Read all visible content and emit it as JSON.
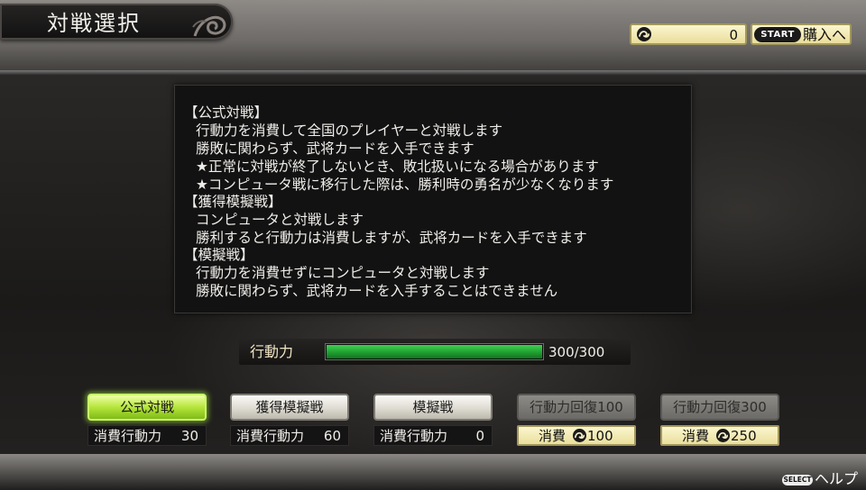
{
  "screen": {
    "title": "対戦選択"
  },
  "currency": {
    "icon": "coin-icon",
    "value": "0"
  },
  "header": {
    "start_badge": "START",
    "purchase_label": "購入へ"
  },
  "description": {
    "lines": [
      "【公式対戦】",
      "行動力を消費して全国のプレイヤーと対戦します",
      "勝敗に関わらず、武将カードを入手できます",
      "★正常に対戦が終了しないとき、敗北扱いになる場合があります",
      "★コンピュータ戦に移行した際は、勝利時の勇名が少なくなります",
      "【獲得模擬戦】",
      "コンピュータと対戦します",
      "勝利すると行動力は消費しますが、武将カードを入手できます",
      "【模擬戦】",
      "行動力を消費せずにコンピュータと対戦します",
      "勝敗に関わらず、武将カードを入手することはできません"
    ]
  },
  "stamina": {
    "label": "行動力",
    "value": "300/300",
    "current": 300,
    "max": 300,
    "fill_fraction": 1.0
  },
  "modes": [
    {
      "label": "公式対戦",
      "state": "selected",
      "cost_label": "消費行動力",
      "cost_value": "30"
    },
    {
      "label": "獲得模擬戦",
      "state": "normal",
      "cost_label": "消費行動力",
      "cost_value": "60"
    },
    {
      "label": "模擬戦",
      "state": "normal",
      "cost_label": "消費行動力",
      "cost_value": "0"
    },
    {
      "label": "行動力回復100",
      "state": "disabled",
      "cost_label": "消費",
      "cost_value": "100"
    },
    {
      "label": "行動力回復300",
      "state": "disabled",
      "cost_label": "消費",
      "cost_value": "250"
    }
  ],
  "footer": {
    "select_badge": "SELECT",
    "help_label": "ヘルプ"
  },
  "colors": {
    "selected_green": "#b6e63c",
    "gauge_green": "#22a533",
    "gold_panel": "#eadf9d"
  }
}
